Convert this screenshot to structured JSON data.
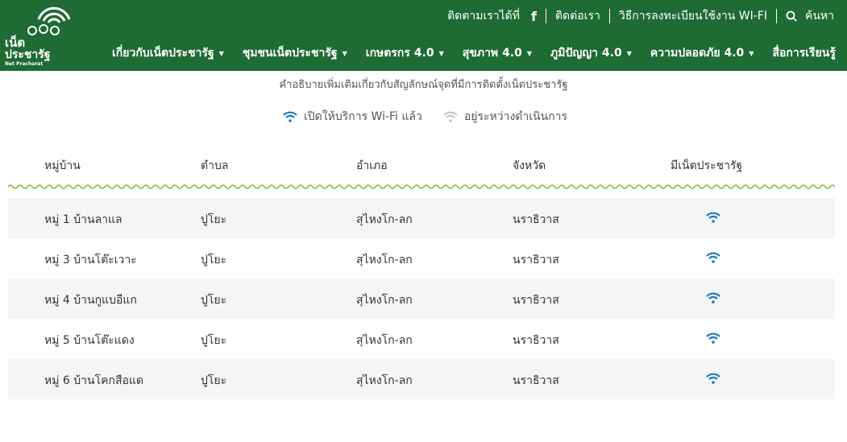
{
  "header": {
    "logo": {
      "line1": "เน็ต",
      "line2": "ประชารัฐ",
      "line3": "Net Pracharat",
      "icon": "wifi-people-logo"
    },
    "topbar": {
      "follow": "ติดตามเราได้ที่",
      "facebook": "f",
      "contact": "ติดต่อเรา",
      "register": "วิธีการลงทะเบียนใช้งาน WI-FI",
      "search": "ค้นหา"
    },
    "nav": [
      {
        "label": "เกี่ยวกับเน็ตประชารัฐ",
        "caret": "▼"
      },
      {
        "label": "ชุมชนเน็ตประชารัฐ",
        "caret": "▼"
      },
      {
        "label": "เกษตรกร 4.0",
        "caret": "▼"
      },
      {
        "label": "สุขภาพ 4.0",
        "caret": "▼"
      },
      {
        "label": "ภูมิปัญญา 4.0",
        "caret": "▼"
      },
      {
        "label": "ความปลอดภัย 4.0",
        "caret": "▼"
      },
      {
        "label": "สื่อการเรียนรู้"
      }
    ]
  },
  "description": "คำอธิบายเพิ่มเติมเกี่ยวกับสัญลักษณ์จุดที่มีการติดตั้งเน็ตประชารัฐ",
  "legend": [
    {
      "label": "เปิดให้บริการ Wi-Fi แล้ว",
      "color": "#1a7bbf",
      "icon": "wifi-icon"
    },
    {
      "label": "อยู่ระหว่างดำเนินการ",
      "color": "#c8c8c8",
      "icon": "wifi-icon"
    }
  ],
  "table": {
    "headers": [
      "หมู่บ้าน",
      "ตำบล",
      "อำเภอ",
      "จังหวัด",
      "มีเน็ตประชารัฐ"
    ],
    "rows": [
      [
        "หมู่ 1 บ้านลาแล",
        "ปูโยะ",
        "สุไหงโก-ลก",
        "นราธิวาส"
      ],
      [
        "หมู่ 3 บ้านโต๊ะเวาะ",
        "ปูโยะ",
        "สุไหงโก-ลก",
        "นราธิวาส"
      ],
      [
        "หมู่ 4 บ้านกูแบอีแก",
        "ปูโยะ",
        "สุไหงโก-ลก",
        "นราธิวาส"
      ],
      [
        "หมู่ 5 บ้านโต๊ะแดง",
        "ปูโยะ",
        "สุไหงโก-ลก",
        "นราธิวาส"
      ],
      [
        "หมู่ 6 บ้านโคกสือแด",
        "ปูโยะ",
        "สุไหงโก-ลก",
        "นราธิวาส"
      ]
    ]
  },
  "colors": {
    "header_bg": "#1e6b34",
    "wave": "#7bc043",
    "row_alt": "#f5f5f5",
    "wifi_on": "#1a7bbf",
    "wifi_pending": "#c8c8c8"
  }
}
